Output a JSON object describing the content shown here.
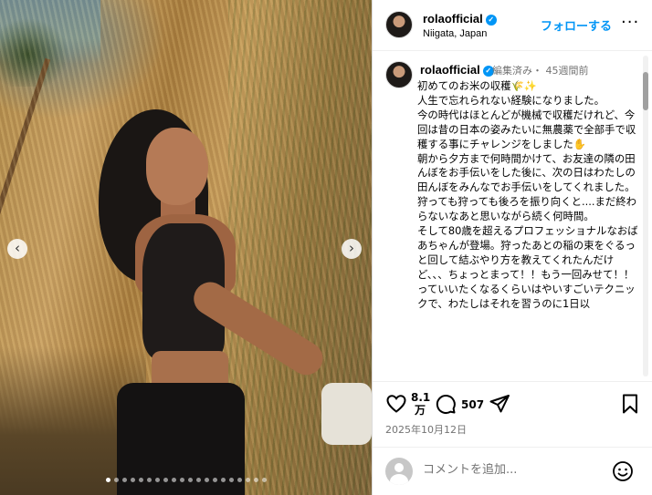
{
  "header": {
    "username": "rolaofficial",
    "location": "Niigata, Japan",
    "follow_label": "フォローする",
    "more_label": "···"
  },
  "post": {
    "username": "rolaofficial",
    "meta": "編集済み・ 45週間前",
    "caption": "初めてのお米の収穫🌾✨\n人生で忘れられない経験になりました。\n今の時代はほとんどが機械で収穫だけれど、今回は昔の日本の姿みたいに無農薬で全部手で収穫する事にチャレンジをしました✋\n朝から夕方まで何時間かけて、お友達の隣の田んぼをお手伝いをした後に、次の日はわたしの田んぼをみんなでお手伝いをしてくれました。 狩っても狩っても後ろを振り向くと....まだ終わらないなあと思いながら続く何時間。\nそして80歳を超えるプロフェッショナルなおばあちゃんが登場。狩ったあとの稲の束をぐるっと回して結ぶやり方を教えてくれたんだけど、、、ちょっとまって！！もう一回みせて！！っていいたくなるくらいはやいすごいテクニックで、わたしはそれを習うのに1日以",
    "like_count": "8.1\n万",
    "comment_count": "507",
    "date": "2025年10月12日"
  },
  "carousel": {
    "prev_label": "‹",
    "next_label": "›",
    "dot_count": 20,
    "active_dot": 0
  },
  "comment_box": {
    "placeholder": "コメントを追加..."
  },
  "icons": {
    "like": "heart-icon",
    "comment": "comment-icon",
    "share": "share-icon",
    "save": "bookmark-icon",
    "emoji": "emoji-icon",
    "verified": "verified-badge-icon"
  },
  "colors": {
    "accent": "#0095f6",
    "muted": "#737373",
    "border": "#dbdbdb"
  }
}
